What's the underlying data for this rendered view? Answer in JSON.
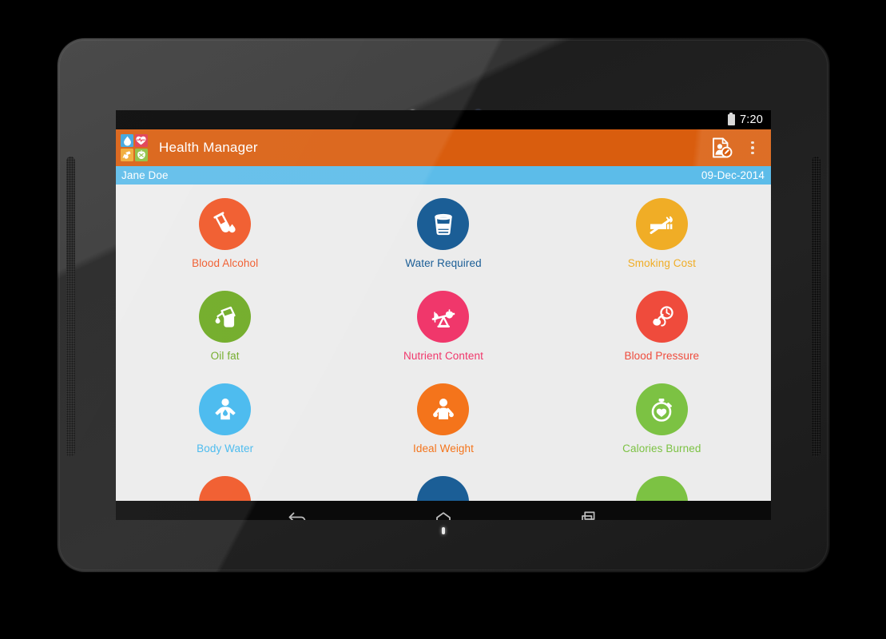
{
  "device": {
    "type": "android-tablet",
    "bezel_color": "#2b2b2b"
  },
  "status_bar": {
    "clock": "7:20",
    "battery_icon": "battery-icon"
  },
  "action_bar": {
    "title": "Health Manager",
    "background": "#d95d0e",
    "logo_tiles": [
      {
        "name": "water-drop",
        "glyph": "●",
        "color": "#3aa3dd"
      },
      {
        "name": "heart-pulse",
        "glyph": "♥",
        "color": "#e0394f"
      },
      {
        "name": "oil-drop",
        "glyph": "◔",
        "color": "#f0a830"
      },
      {
        "name": "apple",
        "glyph": "●",
        "color": "#8cbf3f"
      }
    ],
    "actions": [
      {
        "name": "edit-profile",
        "icon": "profile-document-edit-icon",
        "label": "Edit Profile"
      },
      {
        "name": "overflow",
        "icon": "overflow-menu-icon",
        "label": "More options"
      }
    ]
  },
  "subtitle_bar": {
    "user_name": "Jane Doe",
    "date": "09-Dec-2014",
    "background": "#5cbce9"
  },
  "content": {
    "background": "#ececec",
    "items": [
      {
        "label": "Blood Alcohol",
        "color": "#f05423",
        "icon": "test-tube-drop-icon"
      },
      {
        "label": "Water Required",
        "color": "#1b5e96",
        "icon": "water-glass-icon"
      },
      {
        "label": "Smoking Cost",
        "color": "#f0ad26",
        "icon": "no-smoking-icon"
      },
      {
        "label": "Oil fat",
        "color": "#6ba81e",
        "icon": "oil-can-icon"
      },
      {
        "label": "Nutrient Content",
        "color": "#f0376b",
        "icon": "balance-scale-icon"
      },
      {
        "label": "Blood Pressure",
        "color": "#ef4b3c",
        "icon": "blood-pressure-cuff-icon"
      },
      {
        "label": "Body Water",
        "color": "#3fb7ee",
        "icon": "body-water-icon"
      },
      {
        "label": "Ideal Weight",
        "color": "#f4741b",
        "icon": "ideal-weight-person-icon"
      },
      {
        "label": "Calories Burned",
        "color": "#7cc243",
        "icon": "stopwatch-heart-icon"
      }
    ],
    "partial_row_colors": [
      "#f05423",
      "#1b5e96",
      "#7cc243"
    ]
  },
  "nav_bar": {
    "buttons": [
      {
        "name": "back",
        "icon": "back-arrow-icon",
        "label": "Back"
      },
      {
        "name": "home",
        "icon": "home-icon",
        "label": "Home"
      },
      {
        "name": "recents",
        "icon": "recent-apps-icon",
        "label": "Recent apps"
      }
    ]
  }
}
